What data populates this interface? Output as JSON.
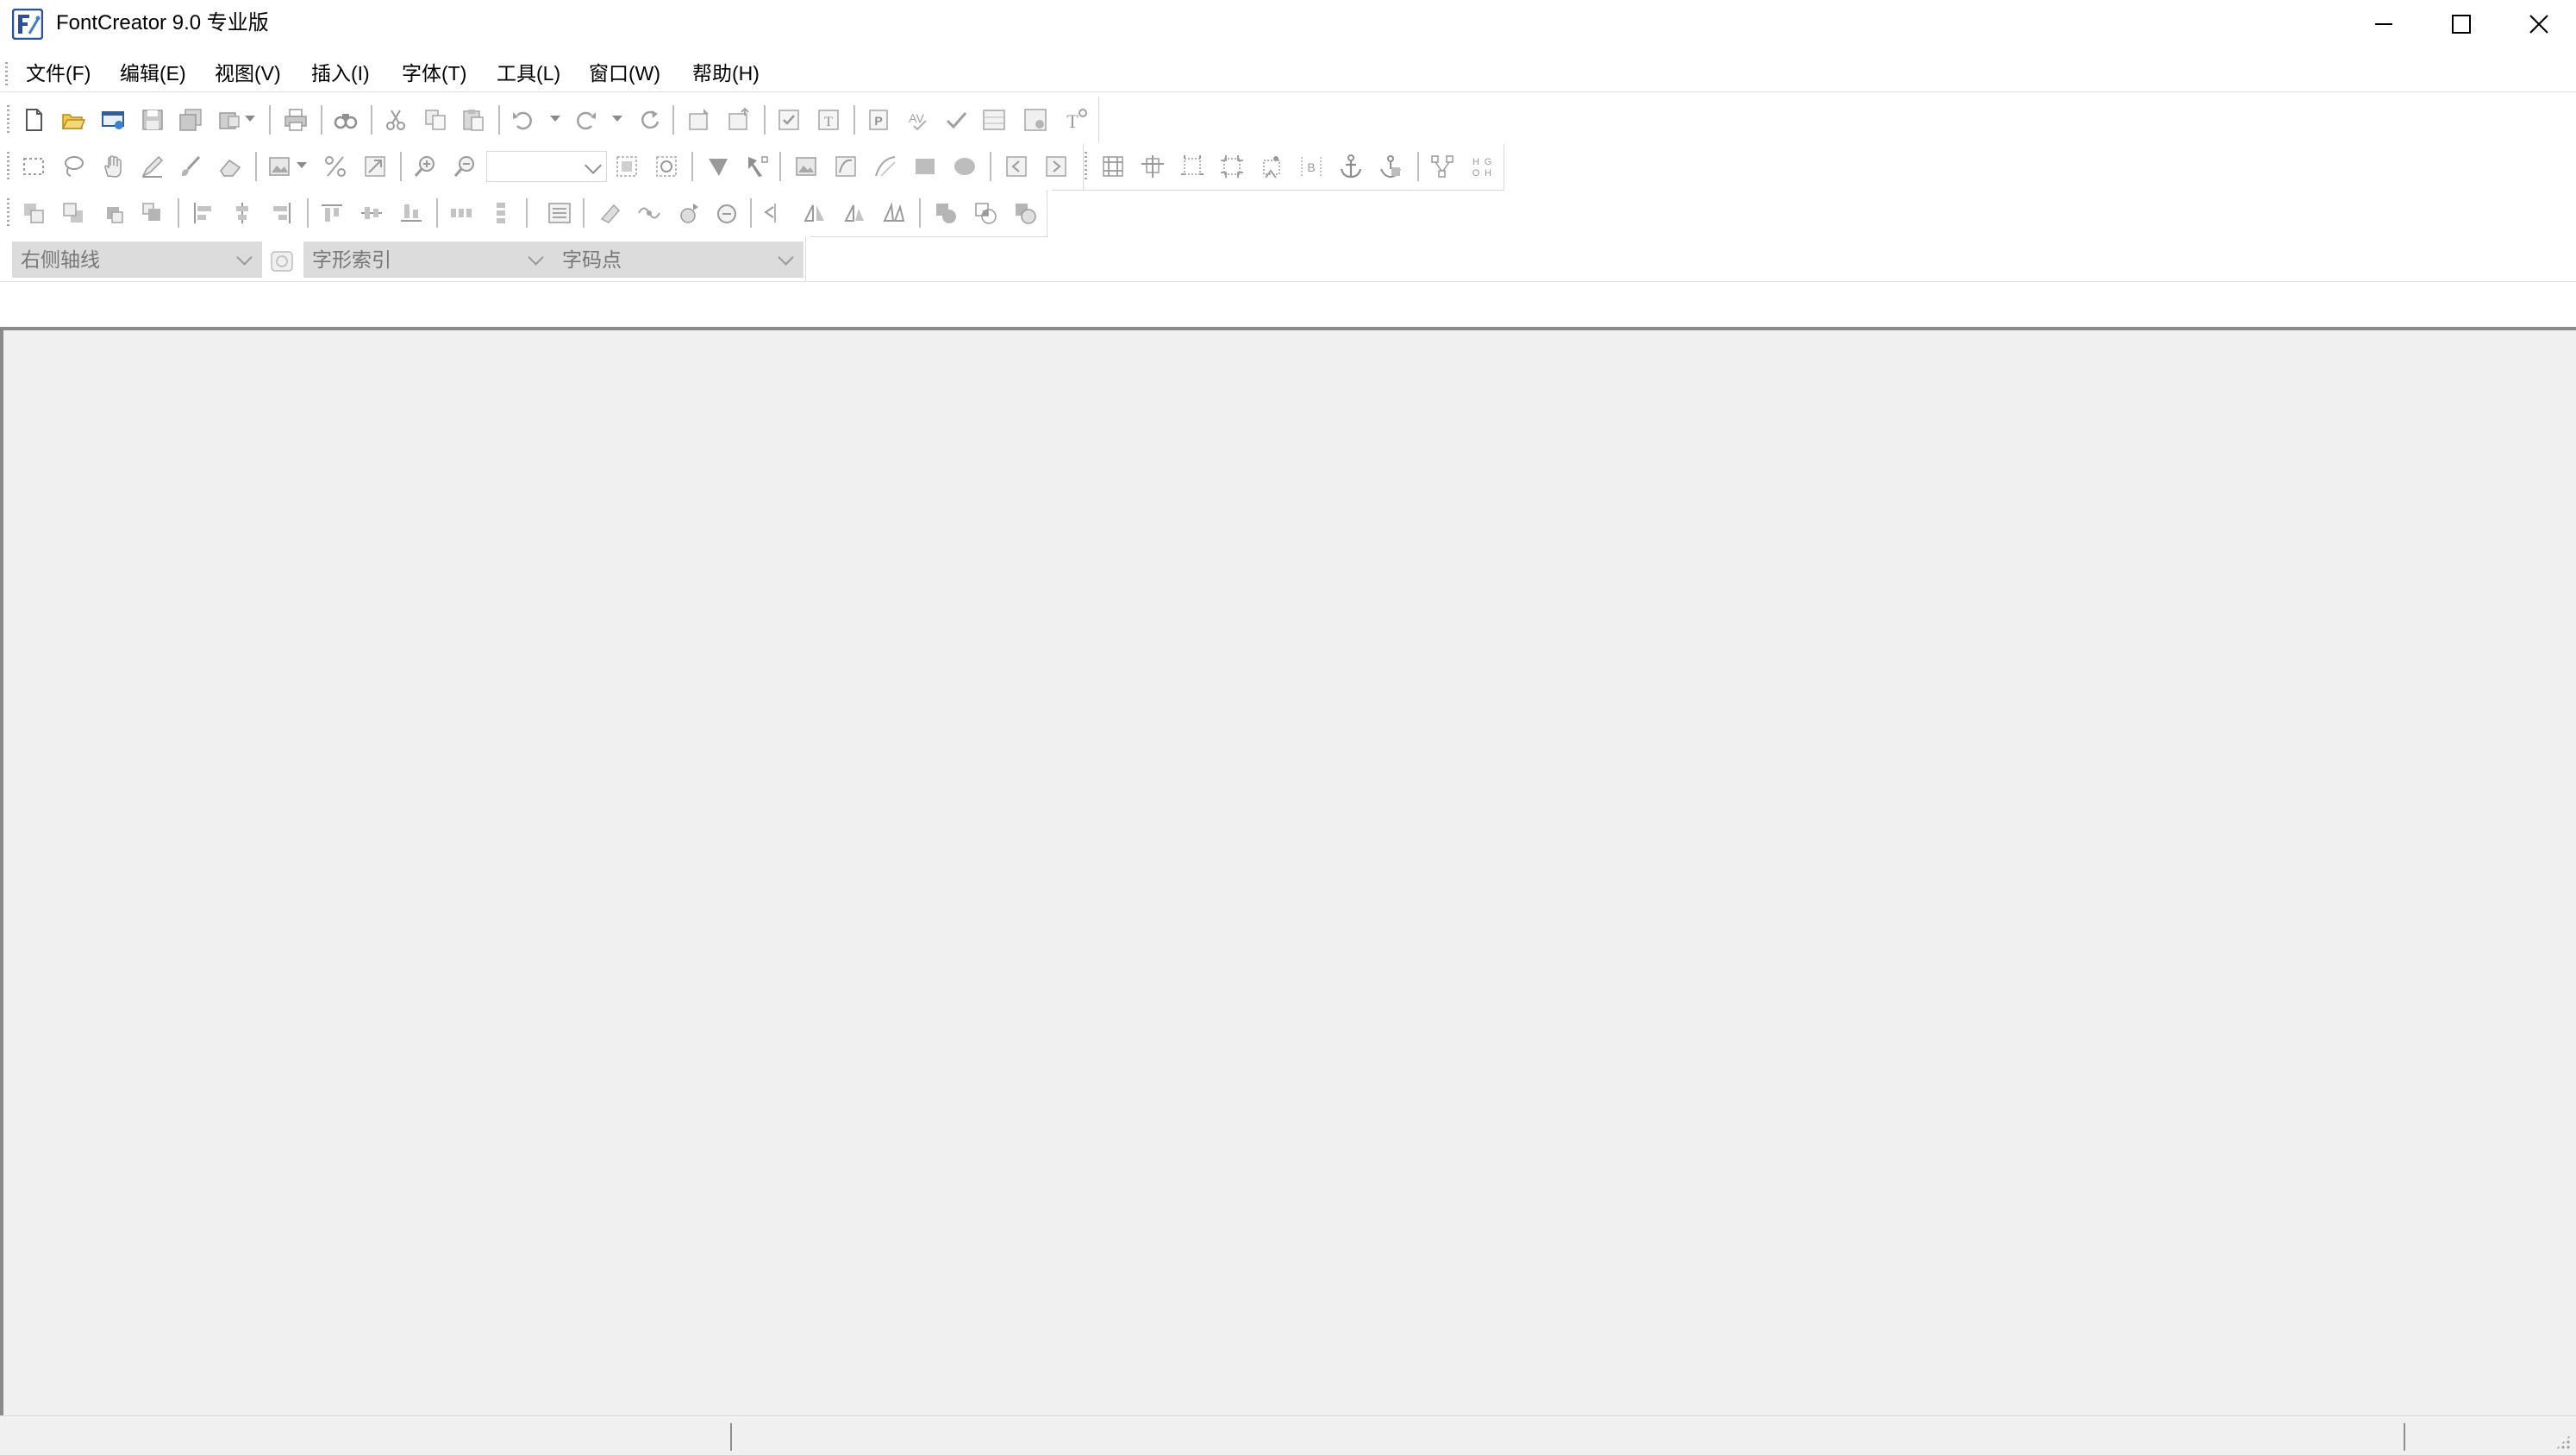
{
  "window": {
    "title": "FontCreator 9.0 专业版",
    "logo_icon": "fontcreator-logo-icon",
    "controls": [
      "minimize-icon",
      "maximize-icon",
      "close-icon"
    ]
  },
  "menu": [
    {
      "label": "文件(F)"
    },
    {
      "label": "编辑(E)"
    },
    {
      "label": "视图(V)"
    },
    {
      "label": "插入(I)"
    },
    {
      "label": "字体(T)"
    },
    {
      "label": "工具(L)"
    },
    {
      "label": "窗口(W)"
    },
    {
      "label": "帮助(H)"
    }
  ],
  "toolbar_row1_icons": [
    "new-file-icon",
    "open-folder-icon",
    "open-web-icon",
    "save-icon",
    "save-all-icon",
    "export-icon",
    "print-icon",
    "find-icon",
    "cut-icon",
    "copy-icon",
    "paste-icon",
    "undo-icon",
    "redo-icon",
    "refresh-icon",
    "import-glyph-icon",
    "export-glyph-icon",
    "validate-icon",
    "test-font-icon",
    "properties-icon",
    "spellcheck-icon",
    "check-icon",
    "glyph-overview-icon",
    "kerning-icon",
    "text-tool-icon"
  ],
  "toolbar_row2_icons": [
    "select-rect-icon",
    "lasso-icon",
    "hand-icon",
    "edit-pen-icon",
    "brush-icon",
    "eraser-icon",
    "image-icon",
    "percent-icon",
    "scale-icon",
    "zoom-in-icon",
    "zoom-out-icon",
    "fit-icon",
    "zoom-select-icon",
    "pointer-icon",
    "transform-icon",
    "background-image-icon",
    "trace-icon",
    "curve-icon",
    "rectangle-icon",
    "ellipse-icon",
    "prev-glyph-icon",
    "next-glyph-icon",
    "grid-icon",
    "guides-icon",
    "metrics-icon",
    "bounds-icon",
    "anchor-points-icon",
    "baseline-icon",
    "anchor-icon",
    "composite-icon",
    "nodes-icon",
    "hint-icon"
  ],
  "toolbar_row3_icons": [
    "bring-front-icon",
    "send-back-icon",
    "bring-forward-icon",
    "send-backward-icon",
    "align-left-icon",
    "align-center-icon",
    "align-right-icon",
    "align-top-icon",
    "align-middle-icon",
    "align-bottom-icon",
    "distribute-h-icon",
    "distribute-v-icon",
    "list-icon",
    "clean-icon",
    "simplify-icon",
    "rotate-icon",
    "reverse-icon",
    "flip-h-icon",
    "mirror-icon",
    "skew-icon",
    "slant-icon",
    "union-icon",
    "intersect-icon",
    "subtract-icon"
  ],
  "dropdowns": {
    "sidebearing": "右侧轴线",
    "glyph_index": "字形索引",
    "codepoint": "字码点"
  }
}
